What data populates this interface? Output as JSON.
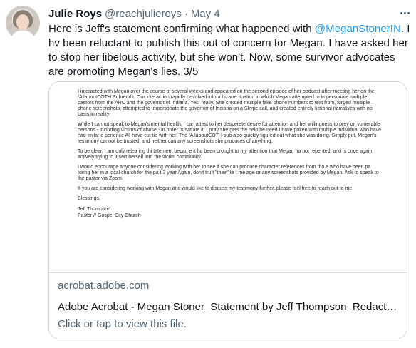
{
  "author": {
    "name": "Julie Roys",
    "handle": "@reachjulieroys",
    "separator": "·",
    "date": "May 4"
  },
  "tweet": {
    "text_before": "Here is Jeff's statement confirming what happened with ",
    "mention": "@MeganStonerIN",
    "text_after": ". I hv been reluctant to publish this out of concern for Megan. I have asked her to stop her libelous activity, but she won't. Now, some survivor advocates are promoting Megan's lies. 3/5"
  },
  "card": {
    "domain": "acrobat.adobe.com",
    "title": "Adobe Acrobat - Megan Stoner_Statement by Jeff Thompson_Redacte...",
    "description": "Click or tap to view this file.",
    "document": {
      "paragraphs": [
        "I interacted with Megan over the course of several weeks and appeared on the second episode of her podcast after meeting her on the /AllaboutCOTH Subreddit. Our interaction   rapidly devolved into a bizarre   ituation in which Megan attempted to impersonate multiple pastors from the ARC and the governor of Indiana. Yes, really. She created multiple fake phone numbers to text from, forged multiple phone screenshots, attempted to impersonate the governor of Indiana on a Skype call, and created entirely fictional narratives with no basis in reality",
        "While I cannot speak to Megan's mental health, I can attest to her desperate desire for attention and her willingness to prey on vulnerable persons - including victims of abuse - in order to satiate it. I pray she gets the help  he need   I have   poken with multiple individual   who have had   imilar e  perience    All have cut tie   with her. The /AllaboutCOTH sub also quickly figured out what she was doing. Simply put, Megan's testimony cannot be trusted, and neither can any screenshots she produces of anything.",
        "To be clear, I am only relea  ing thi    tatement becau  e it ha   been brought to my attention that Megan ha   not repented, and is once again actively trying to insert herself into the victim community.",
        "I would encourage anyone considering working with her to see if she can produce character references from tho  e who have been pa  toring her in a local church for the pa  t 3 year    Again, don't tru  t \"their\" te  t me    age or any screenshots provided by Megan. Ask to speak to the pastor via Zoom.",
        "If you are considering working with Megan and would like to discuss my testimony further, please feel free to reach out to me"
      ],
      "closing": "Blessings,",
      "signature_name": "Jeff Thompson",
      "signature_title": "Pastor // Gospel City Church"
    }
  }
}
